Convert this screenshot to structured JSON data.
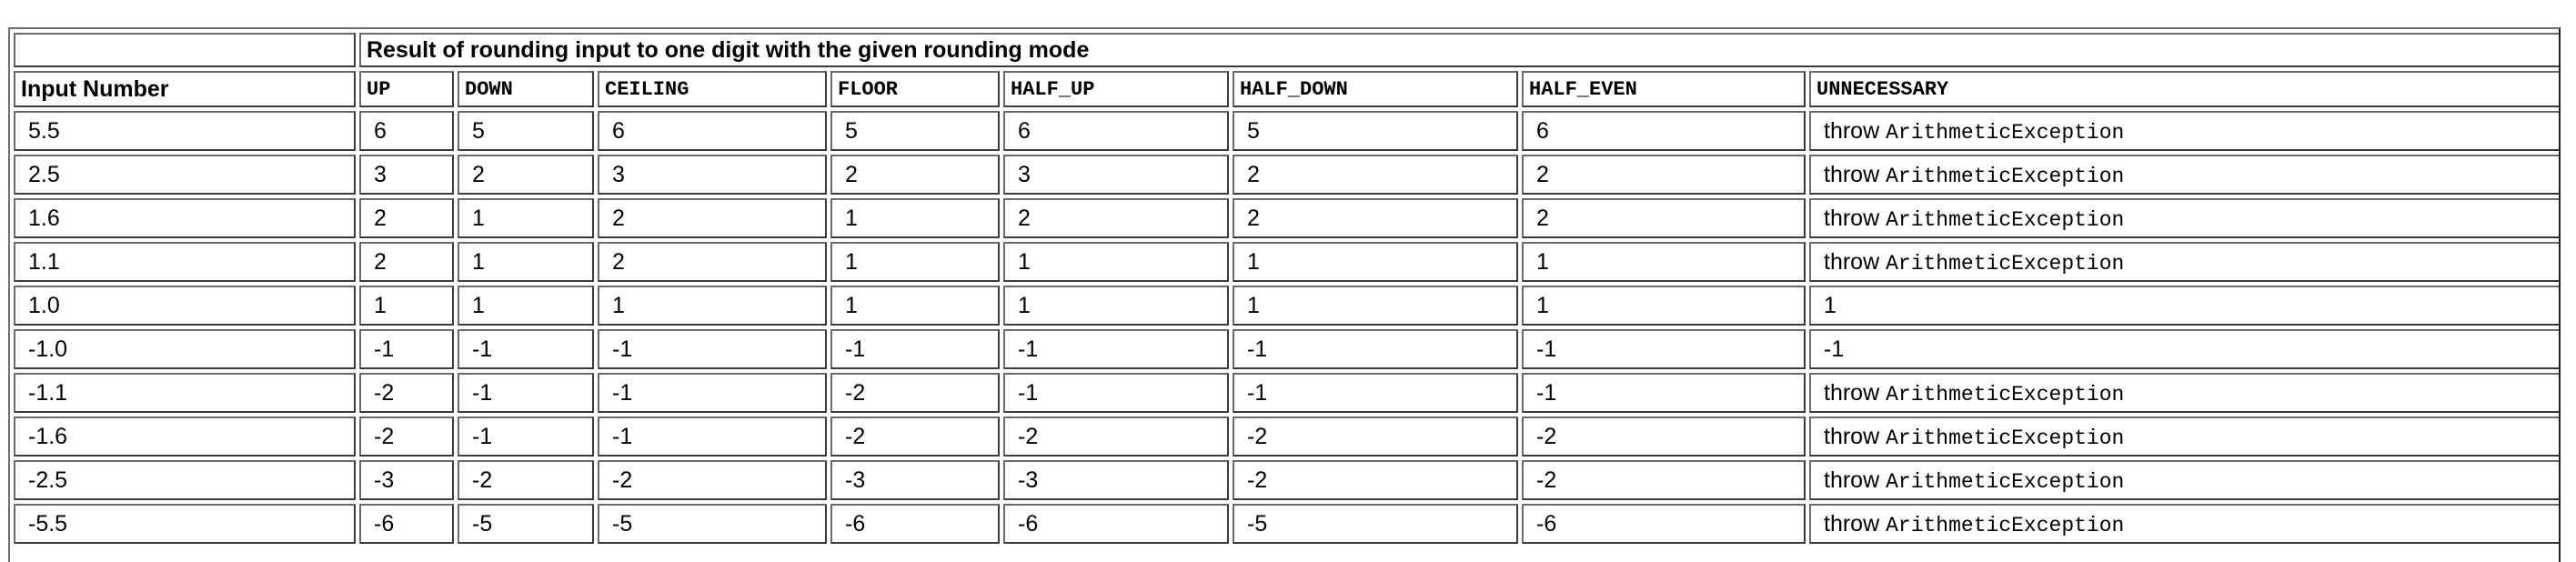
{
  "table": {
    "caption": "Result of rounding input to one digit with the given rounding mode",
    "columns": [
      "Input Number",
      "UP",
      "DOWN",
      "CEILING",
      "FLOOR",
      "HALF_UP",
      "HALF_DOWN",
      "HALF_EVEN",
      "UNNECESSARY"
    ],
    "throw_word": "throw",
    "exception_name": "ArithmeticException",
    "rows": [
      {
        "input": "5.5",
        "up": "6",
        "down": "5",
        "ceiling": "6",
        "floor": "5",
        "half_up": "6",
        "half_down": "5",
        "half_even": "6",
        "unnecessary": null
      },
      {
        "input": "2.5",
        "up": "3",
        "down": "2",
        "ceiling": "3",
        "floor": "2",
        "half_up": "3",
        "half_down": "2",
        "half_even": "2",
        "unnecessary": null
      },
      {
        "input": "1.6",
        "up": "2",
        "down": "1",
        "ceiling": "2",
        "floor": "1",
        "half_up": "2",
        "half_down": "2",
        "half_even": "2",
        "unnecessary": null
      },
      {
        "input": "1.1",
        "up": "2",
        "down": "1",
        "ceiling": "2",
        "floor": "1",
        "half_up": "1",
        "half_down": "1",
        "half_even": "1",
        "unnecessary": null
      },
      {
        "input": "1.0",
        "up": "1",
        "down": "1",
        "ceiling": "1",
        "floor": "1",
        "half_up": "1",
        "half_down": "1",
        "half_even": "1",
        "unnecessary": "1"
      },
      {
        "input": "-1.0",
        "up": "-1",
        "down": "-1",
        "ceiling": "-1",
        "floor": "-1",
        "half_up": "-1",
        "half_down": "-1",
        "half_even": "-1",
        "unnecessary": "-1"
      },
      {
        "input": "-1.1",
        "up": "-2",
        "down": "-1",
        "ceiling": "-1",
        "floor": "-2",
        "half_up": "-1",
        "half_down": "-1",
        "half_even": "-1",
        "unnecessary": null
      },
      {
        "input": "-1.6",
        "up": "-2",
        "down": "-1",
        "ceiling": "-1",
        "floor": "-2",
        "half_up": "-2",
        "half_down": "-2",
        "half_even": "-2",
        "unnecessary": null
      },
      {
        "input": "-2.5",
        "up": "-3",
        "down": "-2",
        "ceiling": "-2",
        "floor": "-3",
        "half_up": "-3",
        "half_down": "-2",
        "half_even": "-2",
        "unnecessary": null
      },
      {
        "input": "-5.5",
        "up": "-6",
        "down": "-5",
        "ceiling": "-5",
        "floor": "-6",
        "half_up": "-6",
        "half_down": "-5",
        "half_even": "-6",
        "unnecessary": null
      }
    ]
  }
}
